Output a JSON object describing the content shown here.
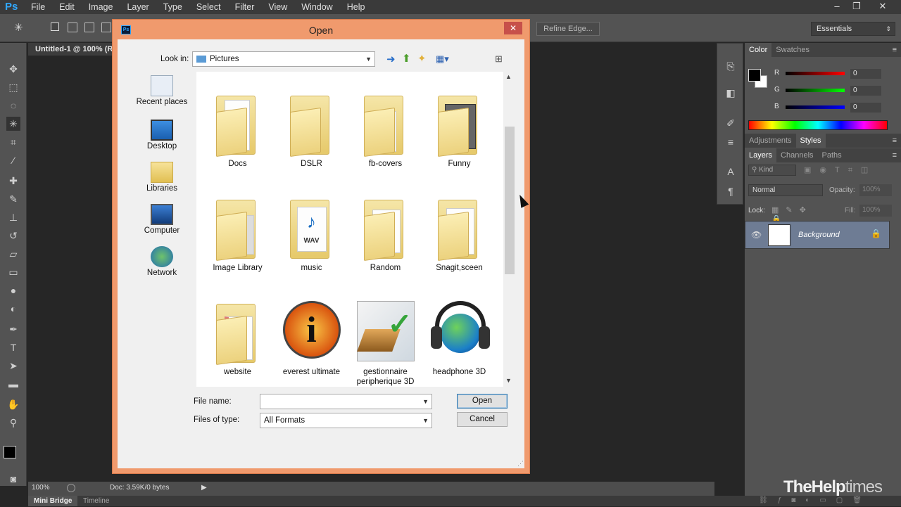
{
  "app": {
    "logo": "Ps"
  },
  "menu": [
    "File",
    "Edit",
    "Image",
    "Layer",
    "Type",
    "Select",
    "Filter",
    "View",
    "Window",
    "Help"
  ],
  "options_bar": {
    "refine_edge": "Refine Edge...",
    "workspace": "Essentials"
  },
  "document": {
    "tab_title": "Untitled-1 @ 100% (R",
    "zoom": "100%",
    "doc_info": "Doc: 3.59K/0 bytes"
  },
  "bottom_tabs": {
    "mini_bridge": "Mini Bridge",
    "timeline": "Timeline"
  },
  "color_panel": {
    "tabs": [
      "Color",
      "Swatches"
    ],
    "r_label": "R",
    "g_label": "G",
    "b_label": "B",
    "r": "0",
    "g": "0",
    "b": "0"
  },
  "adjust_tabs": [
    "Adjustments",
    "Styles"
  ],
  "layers_panel": {
    "tabs": [
      "Layers",
      "Channels",
      "Paths"
    ],
    "filter": "Kind",
    "blend_mode": "Normal",
    "opacity_label": "Opacity:",
    "opacity": "100%",
    "lock_label": "Lock:",
    "fill_label": "Fill:",
    "fill": "100%",
    "layer_name": "Background"
  },
  "dialog": {
    "title": "Open",
    "look_in_label": "Look in:",
    "look_in_value": "Pictures",
    "places": [
      "Recent places",
      "Desktop",
      "Libraries",
      "Computer",
      "Network"
    ],
    "files": [
      "Docs",
      "DSLR",
      "fb-covers",
      "Funny",
      "Image Library",
      "music",
      "Random",
      "Snagit,sceen",
      "website",
      "everest ultimate",
      "gestionnaire peripherique 3D",
      "headphone 3D"
    ],
    "wav_badge": "WAV",
    "file_name_label": "File name:",
    "file_name_value": "",
    "files_of_type_label": "Files of type:",
    "files_of_type_value": "All Formats",
    "open_button": "Open",
    "cancel_button": "Cancel"
  },
  "watermark": {
    "bold": "TheHelp",
    "light": "times"
  },
  "colors": {
    "dialog_frame": "#f09a6d",
    "ps_blue": "#31a8ff",
    "panel_bg": "#535353"
  }
}
